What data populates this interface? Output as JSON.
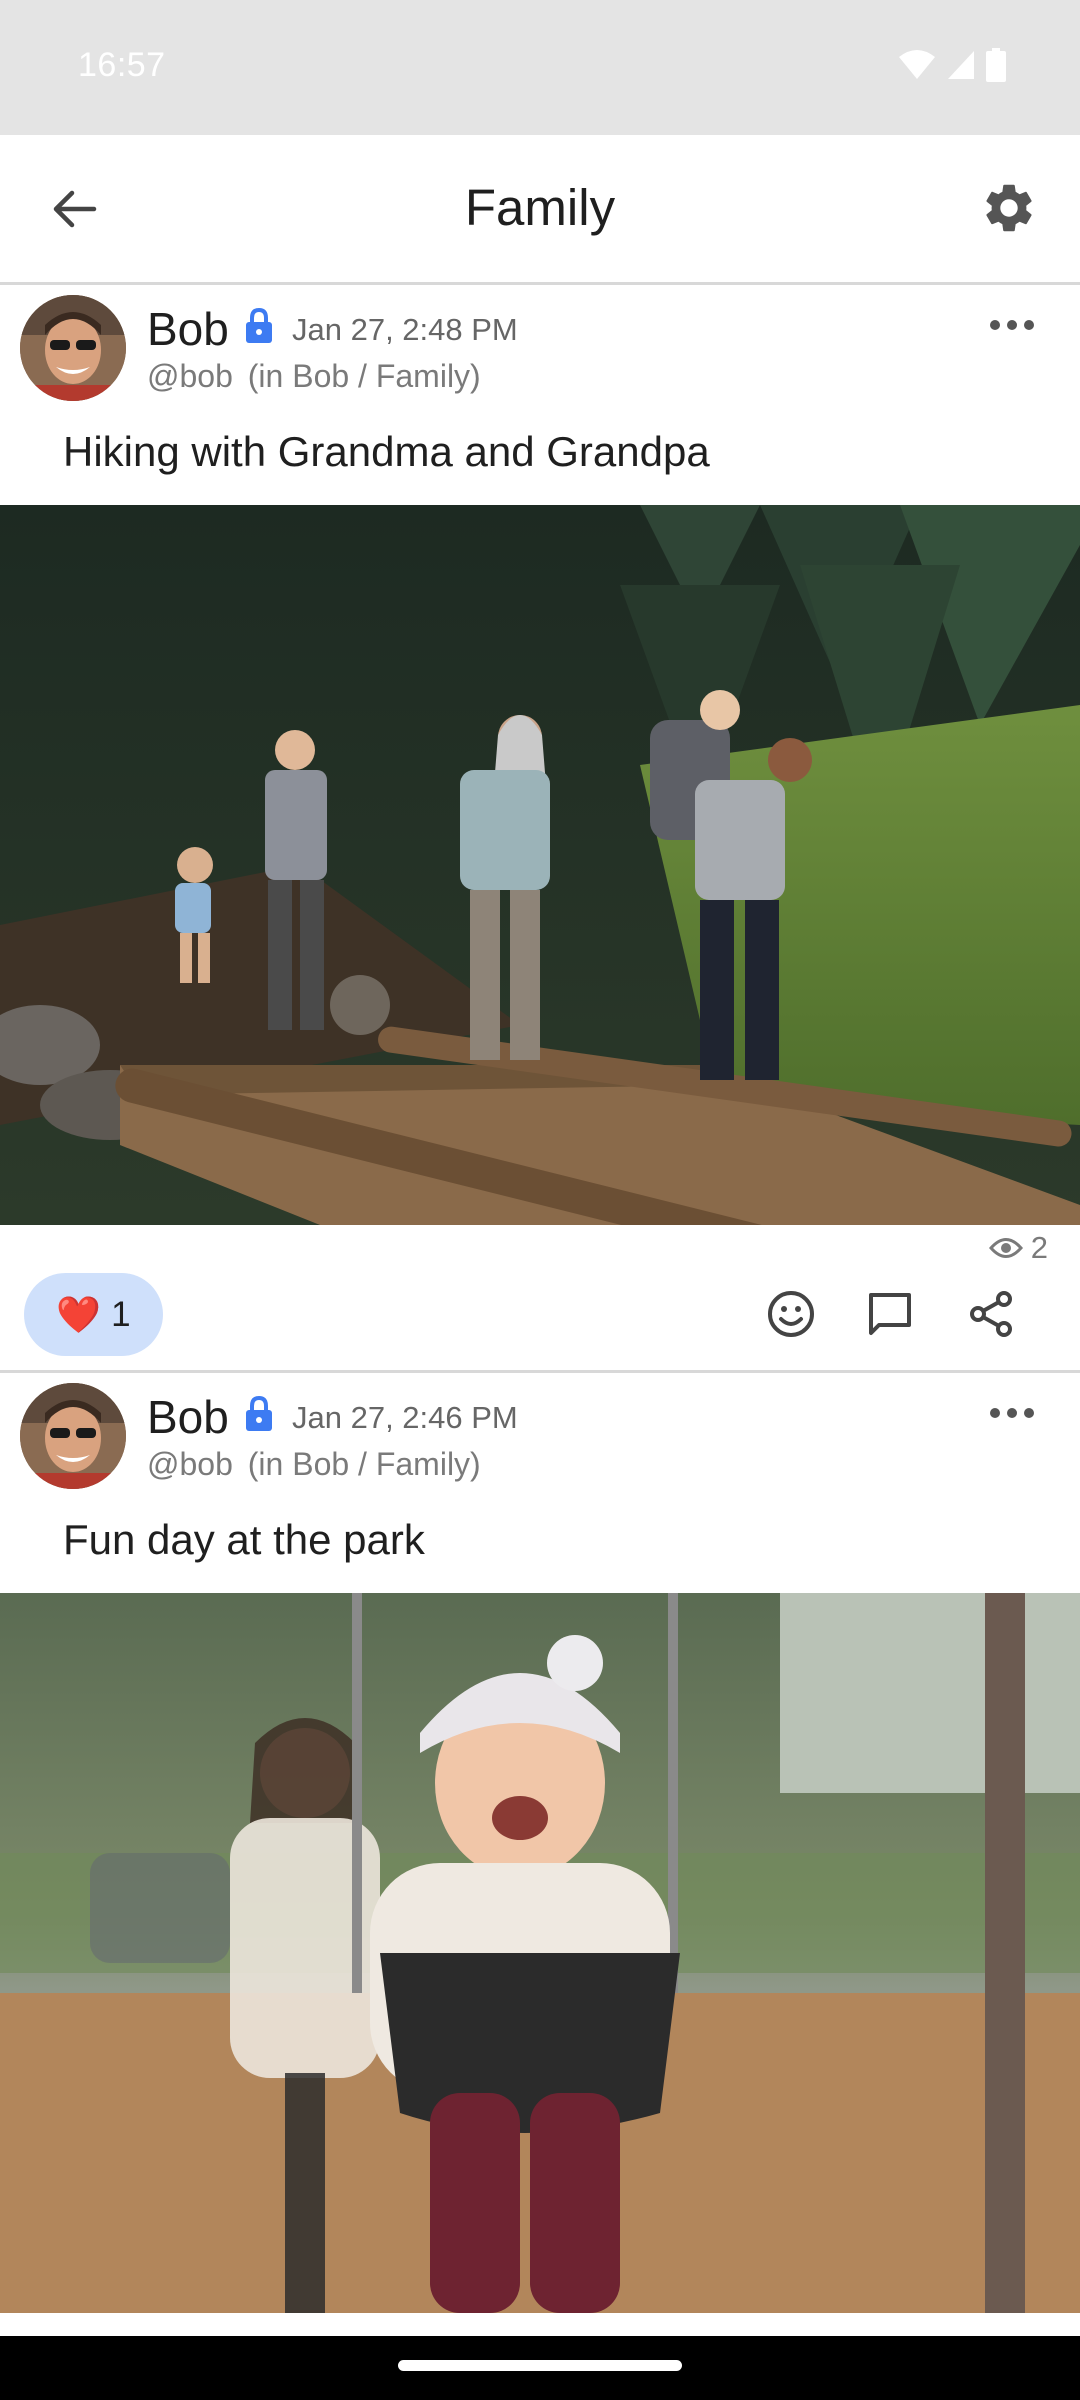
{
  "status_bar": {
    "time": "16:57",
    "icons": [
      "wifi-icon",
      "signal-icon",
      "battery-icon"
    ]
  },
  "app_bar": {
    "title": "Family",
    "back_icon": "arrow-left-icon",
    "settings_icon": "gear-icon"
  },
  "posts": [
    {
      "author": "Bob",
      "handle": "@bob",
      "context": "(in Bob / Family)",
      "timestamp": "Jan 27, 2:48 PM",
      "text": "Hiking with Grandma and Grandpa",
      "photo": "family-hiking-photo",
      "views": "2",
      "reaction": {
        "emoji": "❤️",
        "count": "1"
      }
    },
    {
      "author": "Bob",
      "handle": "@bob",
      "context": "(in Bob / Family)",
      "timestamp": "Jan 27, 2:46 PM",
      "text": "Fun day at the park",
      "photo": "baby-swing-photo"
    }
  ],
  "colors": {
    "accent": "#3d7bf2",
    "reaction_chip": "#cfe0fb",
    "status_bar": "#e4e4e4"
  }
}
